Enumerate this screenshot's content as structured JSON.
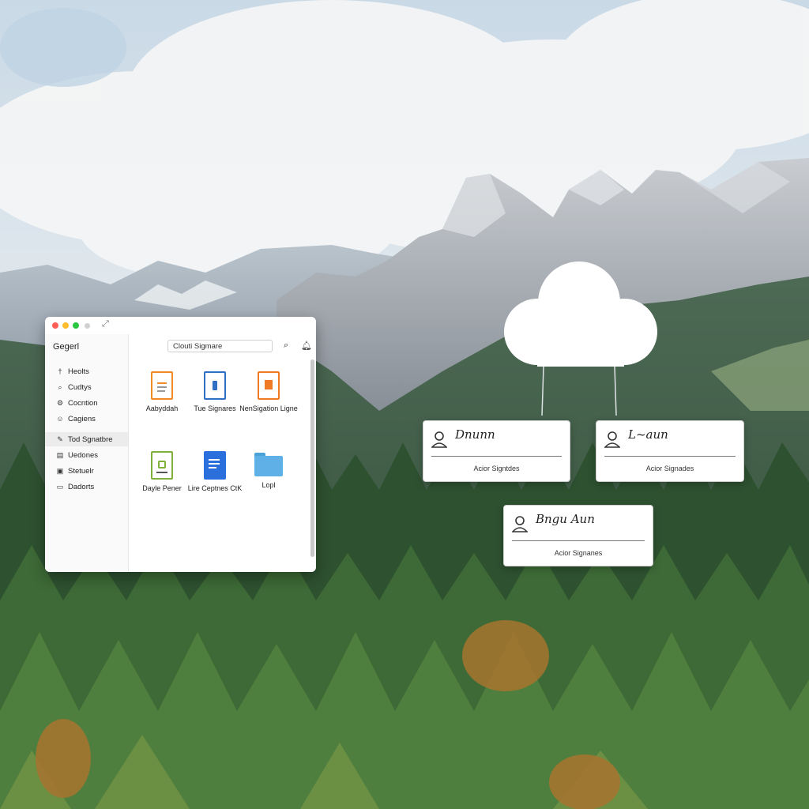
{
  "window": {
    "sidebar_title": "Gegerl",
    "sidebar_items": [
      {
        "icon": "pin-icon",
        "label": "Heolts"
      },
      {
        "icon": "search-icon",
        "label": "Cudtys"
      },
      {
        "icon": "gear-icon",
        "label": "Cocntion"
      },
      {
        "icon": "users-icon",
        "label": "Cagiens"
      },
      {
        "icon": "pen-icon",
        "label": "Tod Sgnatbre",
        "active": true
      },
      {
        "icon": "stack-icon",
        "label": "Uedones"
      },
      {
        "icon": "settings-icon",
        "label": "Stetuelr"
      },
      {
        "icon": "folder-icon",
        "label": "Dadorts"
      }
    ],
    "search_text": "Clouti Sigmare",
    "files": [
      {
        "label": "Aabyddah",
        "icon": "orange-document-icon",
        "color": "#f08a24"
      },
      {
        "label": "Tue Signares",
        "icon": "blue-document-icon",
        "color": "#2f6fc4"
      },
      {
        "label": "NenSigation Ligne",
        "icon": "orange-pdf-icon",
        "color": "#f07a24"
      },
      {
        "label": "Dayle Pener",
        "icon": "green-document-icon",
        "color": "#7fb13a"
      },
      {
        "label": "Lire Ceptnes CtK",
        "icon": "blue-word-document-icon",
        "color": "#2a6fdb"
      },
      {
        "label": "Lopl",
        "icon": "folder-icon",
        "color": "#5fb0e6"
      }
    ]
  },
  "signature_cards": [
    {
      "signature": "Dnunn",
      "caption": "Acior Signtdes"
    },
    {
      "signature": "L~aun",
      "caption": "Acior Signades"
    },
    {
      "signature": "Bngu Aun",
      "caption": "Acior Signanes"
    }
  ],
  "colors": {
    "cloud": "#ffffff",
    "card_border": "#cfcfcf",
    "dot_red": "#ff5f57",
    "dot_yellow": "#febc2e",
    "dot_green": "#28c840"
  }
}
